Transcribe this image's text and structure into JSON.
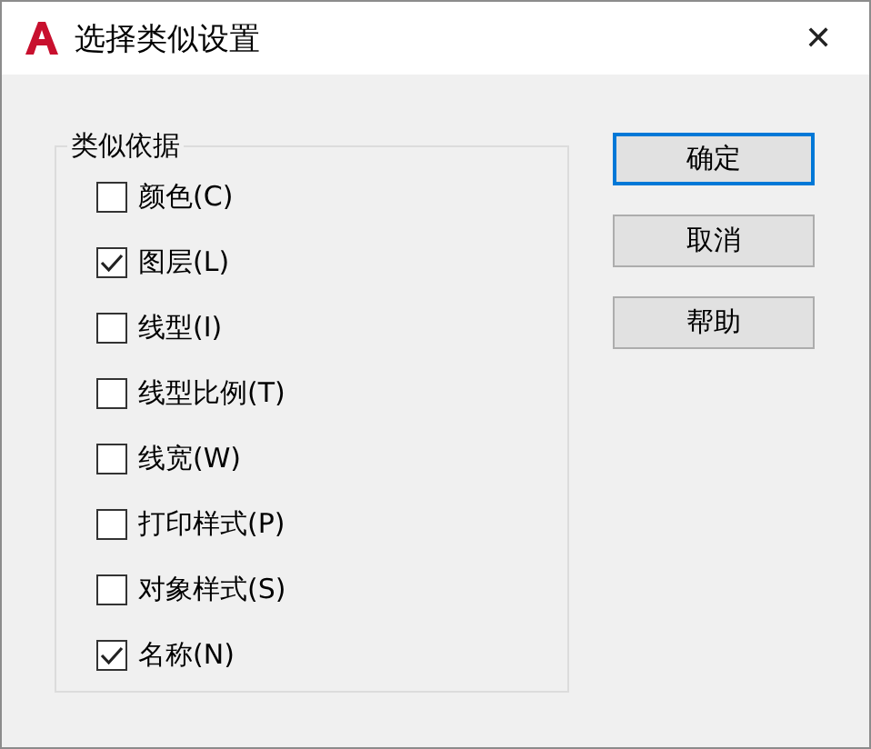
{
  "window": {
    "title": "选择类似设置",
    "close": "✕"
  },
  "group": {
    "title": "类似依据",
    "options": [
      {
        "label": "颜色(C)",
        "checked": false
      },
      {
        "label": "图层(L)",
        "checked": true
      },
      {
        "label": "线型(I)",
        "checked": false
      },
      {
        "label": "线型比例(T)",
        "checked": false
      },
      {
        "label": "线宽(W)",
        "checked": false
      },
      {
        "label": "打印样式(P)",
        "checked": false
      },
      {
        "label": "对象样式(S)",
        "checked": false
      },
      {
        "label": "名称(N)",
        "checked": true
      }
    ]
  },
  "buttons": [
    {
      "label": "确定",
      "kind": "default"
    },
    {
      "label": "取消",
      "kind": "normal"
    },
    {
      "label": "帮助",
      "kind": "normal"
    }
  ]
}
